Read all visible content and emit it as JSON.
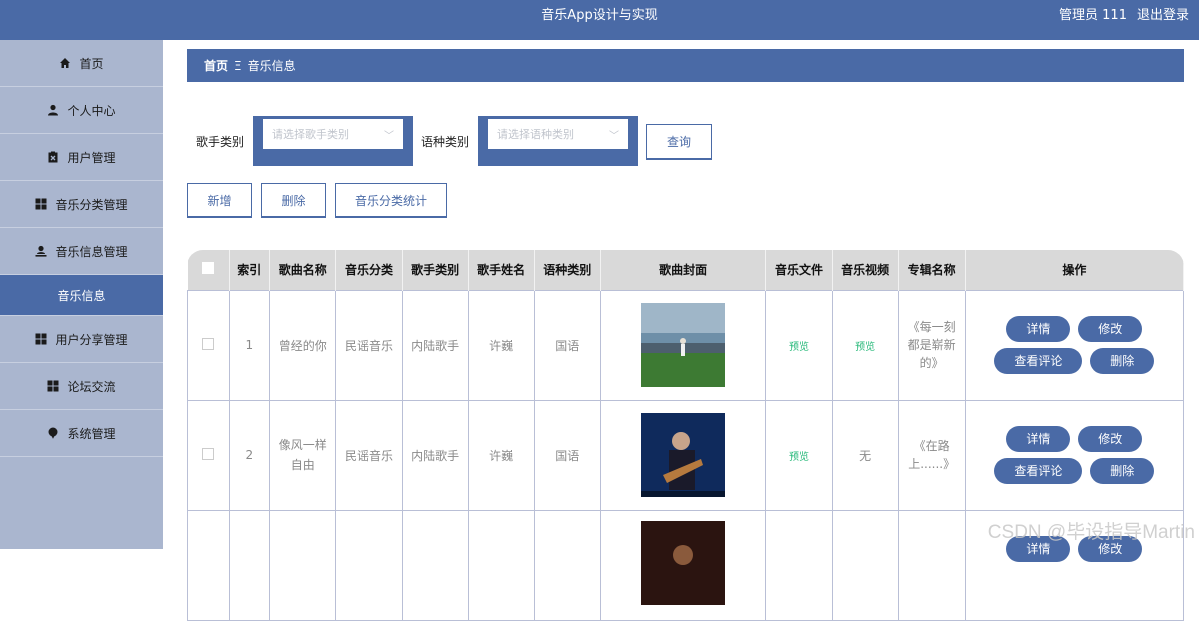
{
  "header": {
    "title": "音乐App设计与实现",
    "user": "管理员 111",
    "logout": "退出登录"
  },
  "sidebar": {
    "items": [
      {
        "label": "首页",
        "icon": "home-icon"
      },
      {
        "label": "个人中心",
        "icon": "user-icon"
      },
      {
        "label": "用户管理",
        "icon": "clipboard-icon"
      },
      {
        "label": "音乐分类管理",
        "icon": "grid-icon"
      },
      {
        "label": "音乐信息管理",
        "icon": "person-upload-icon"
      },
      {
        "label": "音乐信息",
        "icon": "",
        "active": true
      },
      {
        "label": "用户分享管理",
        "icon": "grid-icon"
      },
      {
        "label": "论坛交流",
        "icon": "grid-icon"
      },
      {
        "label": "系统管理",
        "icon": "pin-icon"
      }
    ]
  },
  "breadcrumb": {
    "home": "首页",
    "sep": "Ξ",
    "current": "音乐信息"
  },
  "filters": {
    "singer_label": "歌手类别",
    "singer_placeholder": "请选择歌手类别",
    "language_label": "语种类别",
    "language_placeholder": "请选择语种类别",
    "query": "查询"
  },
  "actions": {
    "add": "新增",
    "delete": "删除",
    "stats": "音乐分类统计"
  },
  "table": {
    "headers": [
      "索引",
      "歌曲名称",
      "音乐分类",
      "歌手类别",
      "歌手姓名",
      "语种类别",
      "歌曲封面",
      "音乐文件",
      "音乐视频",
      "专辑名称",
      "操作"
    ],
    "rows": [
      {
        "index": "1",
        "name": "曾经的你",
        "category": "民谣音乐",
        "singer_type": "内陆歌手",
        "singer": "许巍",
        "language": "国语",
        "file": "预览",
        "video": "预览",
        "album": "《每一刻都是崭新的》"
      },
      {
        "index": "2",
        "name": "像风一样自由",
        "category": "民谣音乐",
        "singer_type": "内陆歌手",
        "singer": "许巍",
        "language": "国语",
        "file": "预览",
        "video": "无",
        "album": "《在路上......》"
      }
    ],
    "ops": {
      "detail": "详情",
      "edit": "修改",
      "comments": "查看评论",
      "delete": "删除"
    }
  },
  "watermark": "CSDN @毕设指导Martin",
  "colors": {
    "primary": "#4a6aa6",
    "sidebar": "#aab6cf",
    "preview": "#25b878"
  }
}
